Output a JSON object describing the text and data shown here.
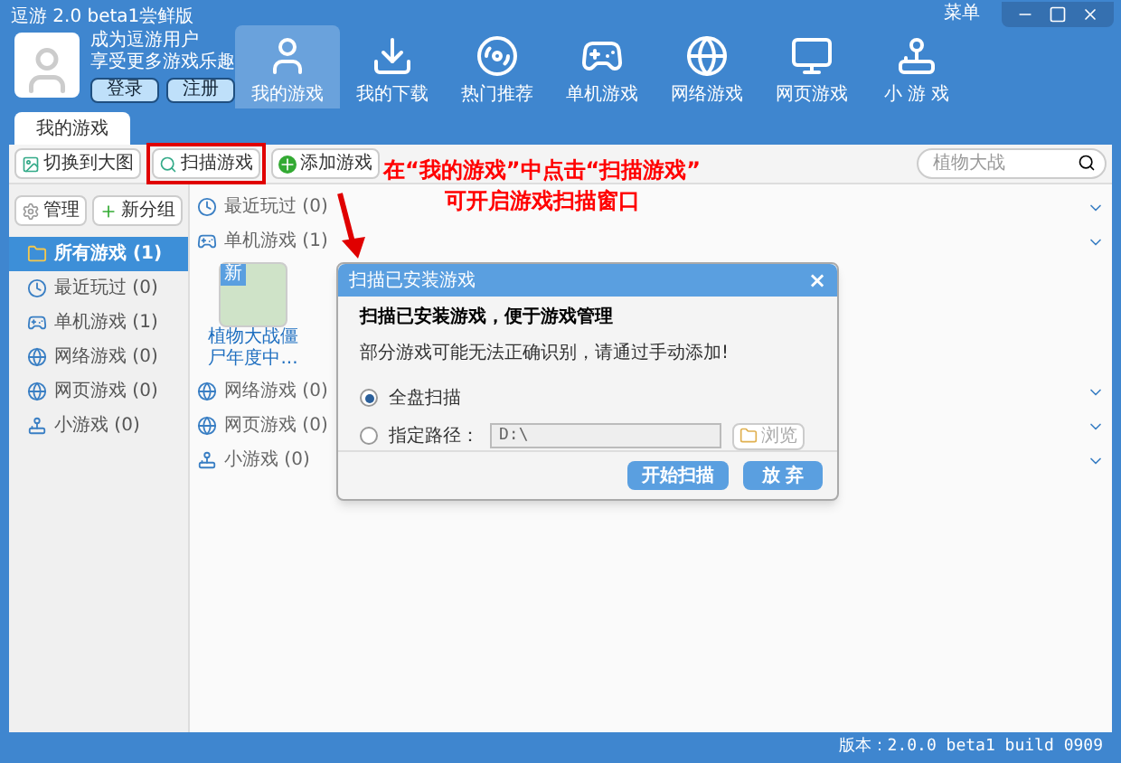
{
  "window": {
    "title": "逗游 2.0 beta1尝鲜版",
    "menu": "菜单"
  },
  "user": {
    "line1": "成为逗游用户",
    "line2": "享受更多游戏乐趣",
    "login": "登录",
    "register": "注册"
  },
  "nav": [
    {
      "label": "我的游戏",
      "selected": true
    },
    {
      "label": "我的下载",
      "selected": false
    },
    {
      "label": "热门推荐",
      "selected": false
    },
    {
      "label": "单机游戏",
      "selected": false
    },
    {
      "label": "网络游戏",
      "selected": false
    },
    {
      "label": "网页游戏",
      "selected": false
    },
    {
      "label": "小 游 戏",
      "selected": false
    }
  ],
  "tabs": [
    {
      "label": "我的游戏",
      "selected": true
    }
  ],
  "toolbar": {
    "switch_view": "切换到大图",
    "scan": "扫描游戏",
    "add": "添加游戏",
    "search_placeholder": "植物大战"
  },
  "annotation": {
    "line1": "在“我的游戏”中点击“扫描游戏”",
    "line2": "可开启游戏扫描窗口"
  },
  "sidebar": {
    "manage": "管理",
    "new_group": "新分组",
    "items": [
      {
        "label": "所有游戏 (1)",
        "selected": true
      },
      {
        "label": "最近玩过 (0)",
        "selected": false
      },
      {
        "label": "单机游戏 (1)",
        "selected": false
      },
      {
        "label": "网络游戏 (0)",
        "selected": false
      },
      {
        "label": "网页游戏 (0)",
        "selected": false
      },
      {
        "label": "小游戏 (0)",
        "selected": false
      }
    ]
  },
  "groups": [
    {
      "label": "最近玩过 (0)"
    },
    {
      "label": "单机游戏 (1)",
      "games": [
        {
          "title": "植物大战僵尸年度中...",
          "badge": "新"
        }
      ]
    },
    {
      "label": "网络游戏 (0)"
    },
    {
      "label": "网页游戏 (0)"
    },
    {
      "label": "小游戏 (0)"
    }
  ],
  "dialog": {
    "title": "扫描已安装游戏",
    "close": "×",
    "heading": "扫描已安装游戏，便于游戏管理",
    "note": "部分游戏可能无法正确识别，请通过手动添加!",
    "options": [
      {
        "label": "全盘扫描",
        "selected": true
      },
      {
        "label": "指定路径：",
        "selected": false
      }
    ],
    "path_value": "D:\\",
    "browse": "浏览",
    "start": "开始扫描",
    "cancel": "放 弃"
  },
  "status_bar": "版本：2.0.0 beta1 build 0909"
}
